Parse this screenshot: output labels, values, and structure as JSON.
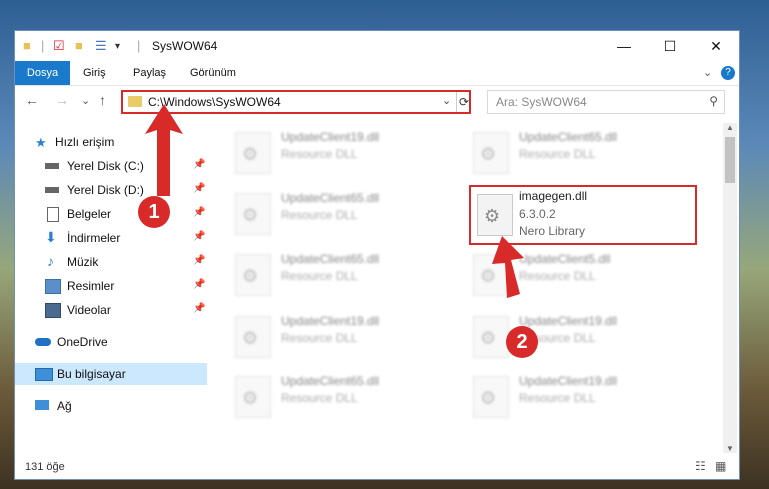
{
  "window": {
    "title": "SysWOW64"
  },
  "controls": {
    "minimize": "—",
    "maximize": "☐",
    "close": "✕"
  },
  "ribbon": {
    "tabs": [
      "Dosya",
      "Giriş",
      "Paylaş",
      "Görünüm"
    ],
    "collapse": "⌄",
    "help": "?"
  },
  "nav": {
    "back": "←",
    "forward": "→",
    "recent": "⌄",
    "up": "↑"
  },
  "address": {
    "path": "C:\\Windows\\SysWOW64",
    "dropdown": "⌄",
    "refresh": "⟳"
  },
  "search": {
    "placeholder": "Ara: SysWOW64",
    "icon": "⚲"
  },
  "sidebar": {
    "items": [
      {
        "label": "Hızlı erişim",
        "icon": "star-icon",
        "pinned": false
      },
      {
        "label": "Yerel Disk (C:)",
        "icon": "drive-icon",
        "pinned": true
      },
      {
        "label": "Yerel Disk (D:)",
        "icon": "drive-icon",
        "pinned": true
      },
      {
        "label": "Belgeler",
        "icon": "documents-icon",
        "pinned": true
      },
      {
        "label": "İndirmeler",
        "icon": "download-icon",
        "pinned": true
      },
      {
        "label": "Müzik",
        "icon": "music-icon",
        "pinned": true
      },
      {
        "label": "Resimler",
        "icon": "pictures-icon",
        "pinned": true
      },
      {
        "label": "Videolar",
        "icon": "videos-icon",
        "pinned": true
      },
      {
        "label": "OneDrive",
        "icon": "onedrive-icon",
        "pinned": false
      },
      {
        "label": "Bu bilgisayar",
        "icon": "computer-icon",
        "pinned": false,
        "selected": true
      },
      {
        "label": "Ağ",
        "icon": "network-icon",
        "pinned": false
      }
    ],
    "pin_glyph": "📌"
  },
  "files": [
    {
      "name": "UpdateClient19.dll",
      "type": "Resource DLL"
    },
    {
      "name": "UpdateClient65.dll",
      "type": "Resource DLL"
    },
    {
      "name": "UpdateClient65.dll",
      "type": "Resource DLL"
    },
    {
      "name": "imagegen.dll",
      "version": "6.3.0.2",
      "description": "Nero Library",
      "highlighted": true
    },
    {
      "name": "UpdateClient65.dll",
      "type": "Resource DLL"
    },
    {
      "name": "UpdateClient5.dll",
      "type": "Resource DLL"
    },
    {
      "name": "UpdateClient19.dll",
      "type": "Resource DLL"
    },
    {
      "name": "UpdateClient19.dll",
      "type": "Resource DLL"
    },
    {
      "name": "UpdateClient65.dll",
      "type": "Resource DLL"
    },
    {
      "name": "UpdateClient19.dll",
      "type": "Resource DLL"
    }
  ],
  "status": {
    "count": "131 öğe"
  },
  "annotations": {
    "step1": "1",
    "step2": "2"
  },
  "colors": {
    "accent": "#1979ca",
    "highlight_red": "#d92a2a"
  }
}
